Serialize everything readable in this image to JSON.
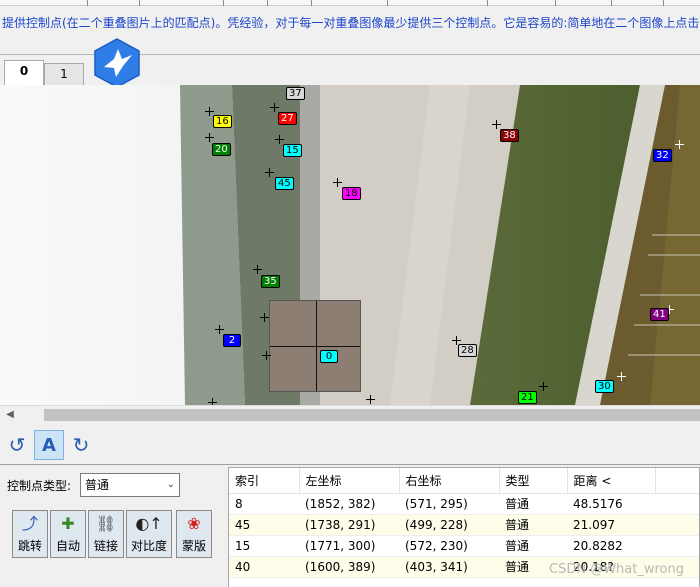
{
  "instruction_text": "提供控制点(在二个重叠图片上的匹配点)。凭经验，对于每一对重叠图像最少提供三个控制点。它是容易的:简单地在二个图像上点击",
  "tabs": [
    {
      "label": "0",
      "active": true
    },
    {
      "label": "1",
      "active": false
    }
  ],
  "control_points": [
    {
      "id": "37",
      "color": "#d8d8d8",
      "text_color": "#000000"
    },
    {
      "id": "16",
      "color": "#ffff00",
      "text_color": "#000000"
    },
    {
      "id": "27",
      "color": "#ff0000",
      "text_color": "#ffffff"
    },
    {
      "id": "38",
      "color": "#8b0000",
      "text_color": "#ffffff"
    },
    {
      "id": "20",
      "color": "#007f00",
      "text_color": "#ffffff"
    },
    {
      "id": "15",
      "color": "#00ffff",
      "text_color": "#000000"
    },
    {
      "id": "32",
      "color": "#0000ff",
      "text_color": "#ffffff"
    },
    {
      "id": "45",
      "color": "#00ffff",
      "text_color": "#000000"
    },
    {
      "id": "18",
      "color": "#ff00ff",
      "text_color": "#000000"
    },
    {
      "id": "35",
      "color": "#007f00",
      "text_color": "#ffffff"
    },
    {
      "id": "2",
      "color": "#0000ff",
      "text_color": "#ffffff"
    },
    {
      "id": "41",
      "color": "#800080",
      "text_color": "#ffffff"
    },
    {
      "id": "0",
      "color": "#00ffff",
      "text_color": "#000000"
    },
    {
      "id": "28",
      "color": "#d8d8d8",
      "text_color": "#000000"
    },
    {
      "id": "30",
      "color": "#00ffff",
      "text_color": "#000000"
    },
    {
      "id": "21",
      "color": "#00ff00",
      "text_color": "#000000"
    }
  ],
  "toolbar": {
    "rotate_left_icon": "rotate-ccw-icon",
    "auto_label": "A",
    "rotate_right_icon": "rotate-cw-icon"
  },
  "left_panel": {
    "cp_type_label": "控制点类型:",
    "cp_type_value": "普通",
    "buttons": [
      {
        "label": "跳转",
        "icon": "jump-icon"
      },
      {
        "label": "自动",
        "icon": "auto-icon"
      },
      {
        "label": "链接",
        "icon": "link-icon"
      },
      {
        "label": "对比度",
        "icon": "contrast-icon"
      },
      {
        "label": "蒙版",
        "icon": "mask-icon"
      }
    ]
  },
  "table": {
    "columns": [
      "索引",
      "左坐标",
      "右坐标",
      "类型",
      "距离 <"
    ],
    "rows": [
      {
        "index": "8",
        "left": "(1852, 382)",
        "right": "(571, 295)",
        "type": "普通",
        "distance": "48.5176"
      },
      {
        "index": "45",
        "left": "(1738, 291)",
        "right": "(499, 228)",
        "type": "普通",
        "distance": "21.097"
      },
      {
        "index": "15",
        "left": "(1771, 300)",
        "right": "(572, 230)",
        "type": "普通",
        "distance": "20.8282"
      },
      {
        "index": "40",
        "left": "(1600, 389)",
        "right": "(403, 341)",
        "type": "普通",
        "distance": "20.18?"
      }
    ]
  },
  "watermark": "CSDN @What_wrong"
}
